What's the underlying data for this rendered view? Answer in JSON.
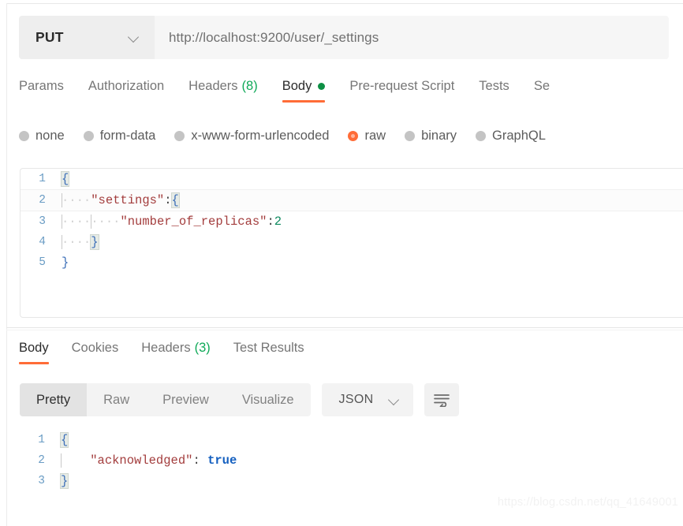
{
  "request": {
    "method": "PUT",
    "url": "http://localhost:9200/user/_settings",
    "method_caret": "chevron-down",
    "tabs": [
      {
        "label": "Params",
        "active": false
      },
      {
        "label": "Authorization",
        "active": false
      },
      {
        "label": "Headers",
        "count": "(8)",
        "active": false
      },
      {
        "label": "Body",
        "active": true,
        "dot": true
      },
      {
        "label": "Pre-request Script",
        "active": false
      },
      {
        "label": "Tests",
        "active": false
      },
      {
        "label": "Se",
        "active": false
      }
    ],
    "body_types": [
      {
        "label": "none",
        "selected": false
      },
      {
        "label": "form-data",
        "selected": false
      },
      {
        "label": "x-www-form-urlencoded",
        "selected": false
      },
      {
        "label": "raw",
        "selected": true
      },
      {
        "label": "binary",
        "selected": false
      },
      {
        "label": "GraphQL",
        "selected": false
      }
    ],
    "body_lines": [
      {
        "num": "1",
        "text": "{"
      },
      {
        "num": "2",
        "text": "    \"settings\":{"
      },
      {
        "num": "3",
        "text": "        \"number_of_replicas\":2"
      },
      {
        "num": "4",
        "text": "    }"
      },
      {
        "num": "5",
        "text": "}"
      }
    ],
    "body_raw": "{\n    \"settings\":{\n        \"number_of_replicas\":2\n    }\n}"
  },
  "response": {
    "tabs": [
      {
        "label": "Body",
        "active": true
      },
      {
        "label": "Cookies",
        "active": false
      },
      {
        "label": "Headers",
        "count": "(3)",
        "active": false
      },
      {
        "label": "Test Results",
        "active": false
      }
    ],
    "view_modes": [
      {
        "label": "Pretty",
        "active": true
      },
      {
        "label": "Raw",
        "active": false
      },
      {
        "label": "Preview",
        "active": false
      },
      {
        "label": "Visualize",
        "active": false
      }
    ],
    "format": "JSON",
    "format_caret": "chevron-down",
    "wrap_button": "wrap-lines",
    "body_lines": [
      {
        "num": "1",
        "text": "{"
      },
      {
        "num": "2",
        "text": "    \"acknowledged\": true"
      },
      {
        "num": "3",
        "text": "}"
      }
    ],
    "body_raw": "{\n    \"acknowledged\": true\n}"
  },
  "watermark": "https://blog.csdn.net/qq_41649001",
  "colors": {
    "accent": "#ff6c37",
    "success": "#0fa958",
    "body_dot": "#0d8f44",
    "json_key": "#a33d3d",
    "json_number": "#0f8a5f",
    "json_bool": "#1560c0",
    "json_punct": "#3d6fb8",
    "line_number": "#6a9cc4"
  }
}
